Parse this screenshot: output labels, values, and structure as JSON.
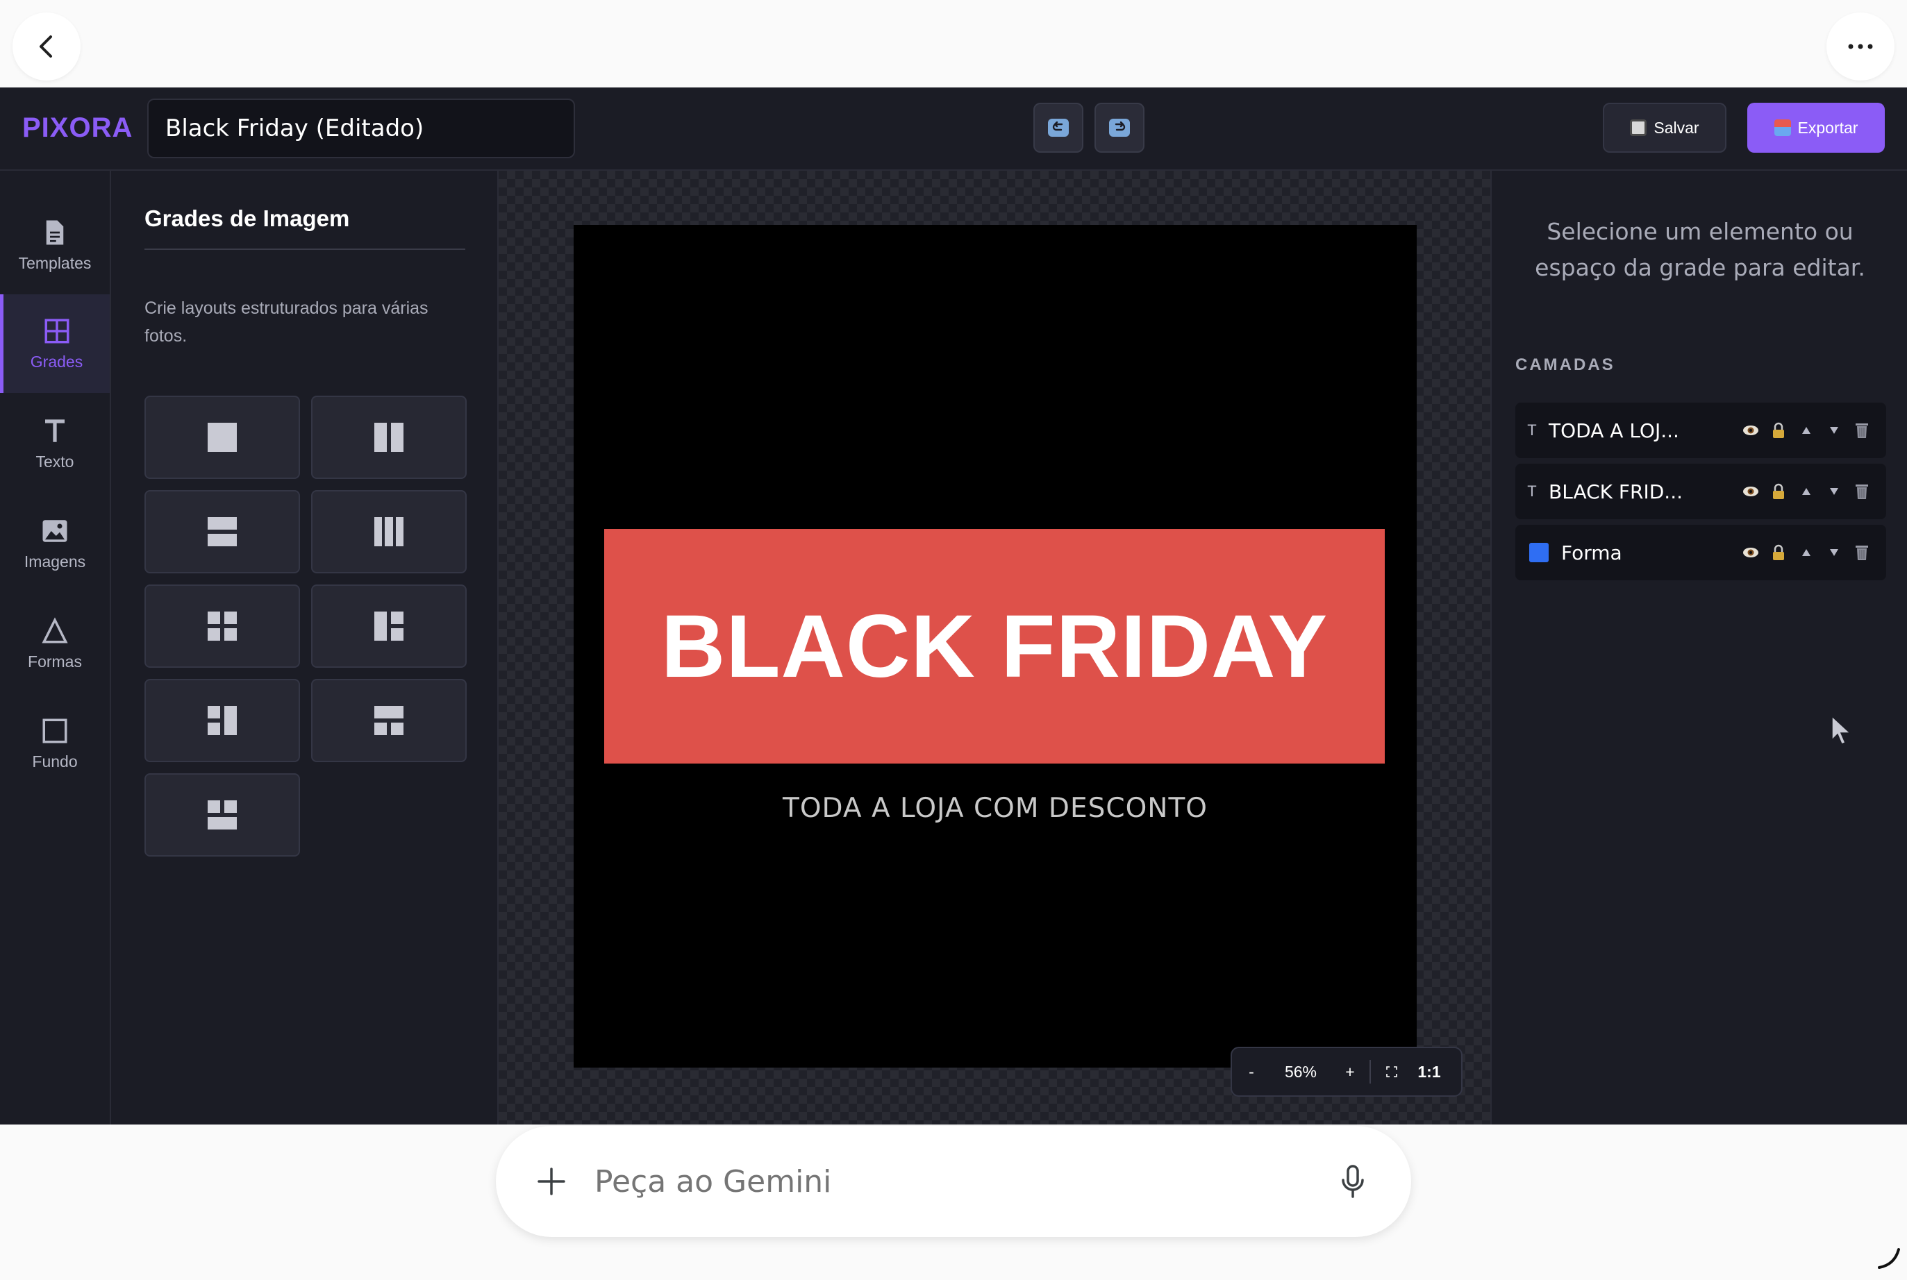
{
  "chrome": {
    "back_icon": "chevron-left-icon",
    "more_icon": "more-horizontal-icon"
  },
  "header": {
    "brand": "PIXORA",
    "document_title": "Black Friday (Editado)",
    "undo_icon": "undo-icon",
    "redo_icon": "redo-icon",
    "save_label": "Salvar",
    "export_label": "Exportar",
    "accent_color": "#8b5cf6"
  },
  "rail": {
    "items": [
      {
        "label": "Templates",
        "icon": "document-icon"
      },
      {
        "label": "Grades",
        "icon": "grid-icon",
        "active": true
      },
      {
        "label": "Texto",
        "icon": "text-icon"
      },
      {
        "label": "Imagens",
        "icon": "image-icon"
      },
      {
        "label": "Formas",
        "icon": "triangle-icon"
      },
      {
        "label": "Fundo",
        "icon": "square-icon"
      }
    ]
  },
  "panel": {
    "title": "Grades de Imagem",
    "description": "Crie layouts estruturados para várias fotos.",
    "grid_layouts": [
      "single",
      "two-columns",
      "two-rows",
      "three-columns",
      "four-grid",
      "left-big-right-two",
      "left-two-right-big",
      "top-two-bottom-one",
      "top-one-bottom-two"
    ]
  },
  "canvas": {
    "headline": "BLACK FRIDAY",
    "subline": "TODA A LOJA COM DESCONTO",
    "shape_color": "#de514a",
    "background_color": "#000000",
    "zoom": {
      "minus": "-",
      "level": "56%",
      "plus": "+",
      "fit_icon": "fit-screen-icon",
      "actual": "1:1"
    }
  },
  "right_panel": {
    "hint": "Selecione um elemento ou espaço da grade para editar.",
    "layers_title": "CAMADAS",
    "layers": [
      {
        "type": "T",
        "name": "TODA A LOJ..."
      },
      {
        "type": "T",
        "name": "BLACK FRID..."
      },
      {
        "type": "shape",
        "name": "Forma",
        "color": "#2f6ef3"
      }
    ],
    "layer_action_icons": [
      "eye-icon",
      "lock-icon",
      "arrow-up-icon",
      "arrow-down-icon",
      "trash-icon"
    ]
  },
  "gemini": {
    "placeholder": "Peça ao Gemini",
    "plus_icon": "plus-icon",
    "mic_icon": "microphone-icon"
  }
}
